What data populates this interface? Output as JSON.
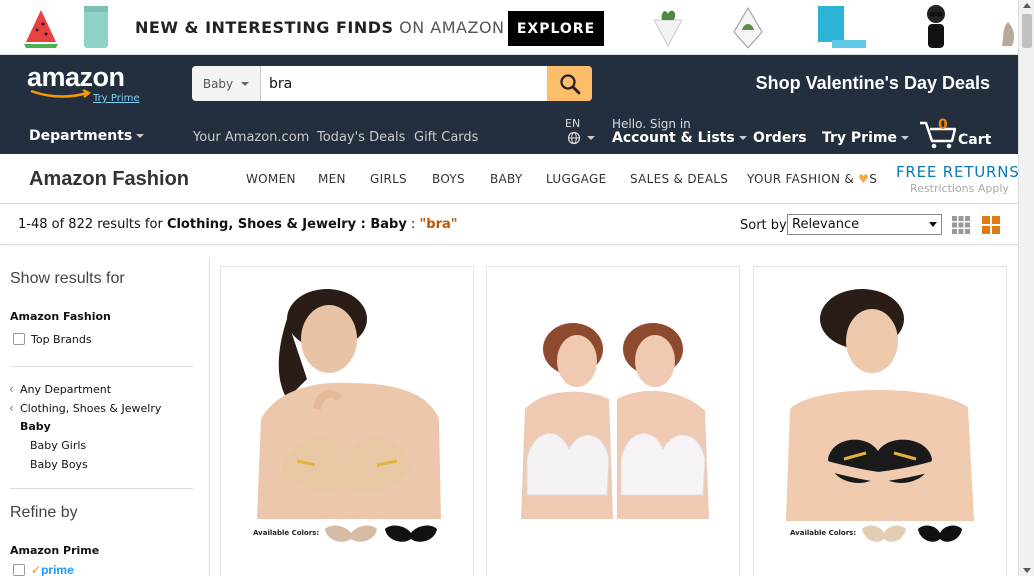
{
  "promo": {
    "headline_bold": "NEW & INTERESTING FINDS",
    "headline_light": " ON AMAZON",
    "explore_label": "EXPLORE"
  },
  "header": {
    "logo_text": "amazon",
    "try_prime_small": "Try Prime",
    "search_dept": "Baby",
    "search_value": "bra",
    "promo_deal": "Shop Valentine's Day Deals",
    "departments": "Departments",
    "links": [
      "Your Amazon.com",
      "Today's Deals",
      "Gift Cards"
    ],
    "lang": "EN",
    "signin_small": "Hello. Sign in",
    "account": "Account & Lists",
    "orders": "Orders",
    "try_prime": "Try Prime",
    "cart_count": "0",
    "cart_label": "Cart"
  },
  "fashion": {
    "title": "Amazon Fashion",
    "categories": [
      "WOMEN",
      "MEN",
      "GIRLS",
      "BOYS",
      "BABY",
      "LUGGAGE",
      "SALES & DEALS"
    ],
    "your_fashion_pre": "YOUR FASHION & ",
    "your_fashion_post": "S",
    "free_returns": "FREE RETURNS",
    "restrictions": "Restrictions Apply"
  },
  "results": {
    "count_text": "1-48 of 822 results for ",
    "category_path": "Clothing, Shoes & Jewelry : Baby",
    "separator": " : ",
    "query": "\"bra\"",
    "sort_label": "Sort by",
    "sort_value": "Relevance"
  },
  "sidebar": {
    "show_results": "Show results for",
    "amazon_fashion": "Amazon Fashion",
    "top_brands": "Top Brands",
    "any_department": "Any Department",
    "clothing": "Clothing, Shoes & Jewelry",
    "baby": "Baby",
    "baby_girls": "Baby Girls",
    "baby_boys": "Baby Boys",
    "refine_by": "Refine by",
    "amazon_prime": "Amazon Prime",
    "prime_logo": "prime"
  },
  "products": [
    {
      "available_colors": "Available Colors:"
    },
    {},
    {
      "available_colors": "Available Colors:"
    }
  ],
  "colors": {
    "nav_bg": "#232f3e",
    "search_btn": "#febd69",
    "link_blue": "#0a7ab5",
    "query_orange": "#c45500"
  }
}
